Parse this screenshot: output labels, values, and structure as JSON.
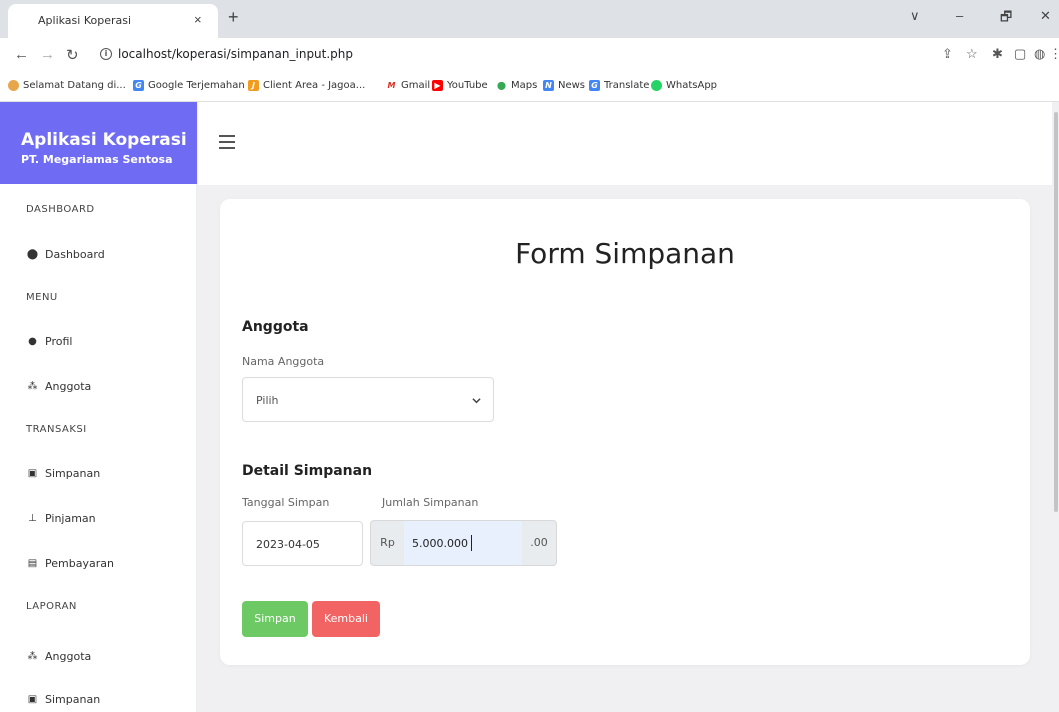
{
  "browser": {
    "tab_title": "Aplikasi Koperasi",
    "tab_close": "×",
    "new_tab": "+",
    "url": "localhost/koperasi/simpanan_input.php",
    "window_controls": [
      "∨",
      "–",
      "🗗",
      "✕"
    ],
    "bookmarks": [
      {
        "label": "Selamat Datang di...",
        "icon": "globe-icon",
        "color": "#e8a64a"
      },
      {
        "label": "Google Terjemahan",
        "icon": "translate-icon",
        "color": "#4285f4"
      },
      {
        "label": "Client Area - Jagoa...",
        "icon": "jagoan-icon",
        "color": "#f29b1d"
      },
      {
        "label": "Gmail",
        "icon": "gmail-icon",
        "color": "#d93025"
      },
      {
        "label": "YouTube",
        "icon": "youtube-icon",
        "color": "#ff0000"
      },
      {
        "label": "Maps",
        "icon": "maps-icon",
        "color": "#34a853"
      },
      {
        "label": "News",
        "icon": "news-icon",
        "color": "#4285f4"
      },
      {
        "label": "Translate",
        "icon": "translate-icon",
        "color": "#4285f4"
      },
      {
        "label": "WhatsApp",
        "icon": "whatsapp-icon",
        "color": "#25d366"
      }
    ]
  },
  "sidebar": {
    "brand_title": "Aplikasi Koperasi",
    "brand_subtitle": "PT. Megariamas Sentosa",
    "brand_color": "#6f6cf3",
    "sections": [
      {
        "heading": "DASHBOARD",
        "items": [
          {
            "label": "Dashboard",
            "icon": "palette-icon"
          }
        ]
      },
      {
        "heading": "MENU",
        "items": [
          {
            "label": "Profil",
            "icon": "user-icon"
          },
          {
            "label": "Anggota",
            "icon": "users-icon"
          }
        ]
      },
      {
        "heading": "TRANSAKSI",
        "items": [
          {
            "label": "Simpanan",
            "icon": "wallet-icon"
          },
          {
            "label": "Pinjaman",
            "icon": "hand-holding-icon"
          },
          {
            "label": "Pembayaran",
            "icon": "money-icon"
          }
        ]
      },
      {
        "heading": "LAPORAN",
        "items": [
          {
            "label": "Anggota",
            "icon": "users-icon"
          },
          {
            "label": "Simpanan",
            "icon": "wallet-icon"
          }
        ]
      }
    ]
  },
  "form": {
    "title": "Form Simpanan",
    "anggota_heading": "Anggota",
    "nama_anggota_label": "Nama Anggota",
    "nama_anggota_value": "Pilih",
    "detail_heading": "Detail Simpanan",
    "tanggal_label": "Tanggal Simpan",
    "tanggal_value": "2023-04-05",
    "jumlah_label": "Jumlah Simpanan",
    "jumlah_prefix": "Rp",
    "jumlah_value": "5.000.000",
    "jumlah_suffix": ".00",
    "save_label": "Simpan",
    "back_label": "Kembali",
    "save_color": "#6dc964",
    "back_color": "#f26464"
  }
}
